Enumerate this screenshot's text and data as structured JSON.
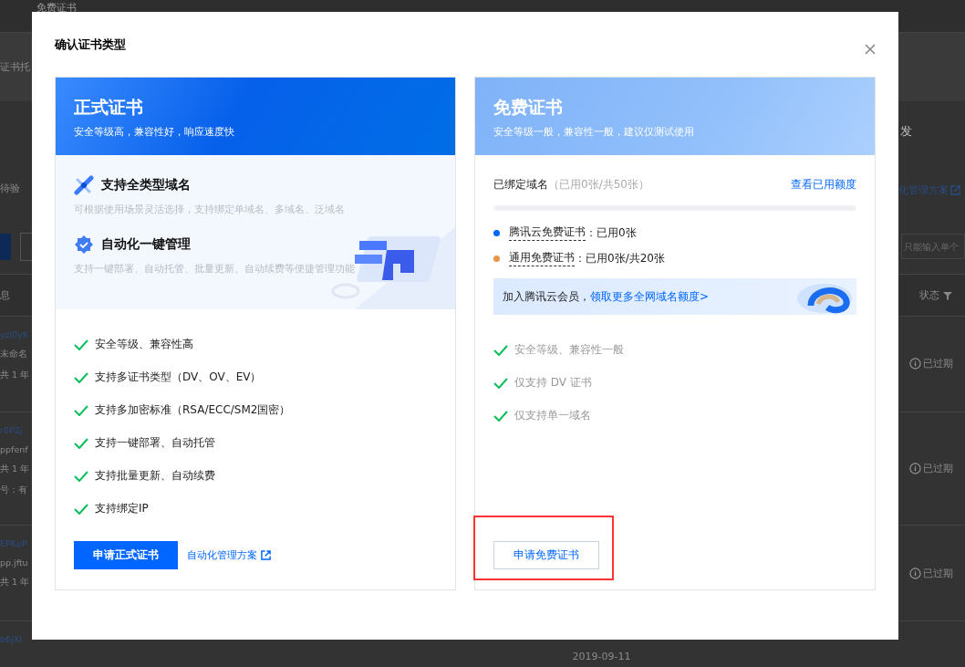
{
  "background": {
    "page_title": "免费证书",
    "tab_label": "证书托",
    "pending_label": "待验",
    "right_heading": "发",
    "right_link": "化管理方案",
    "search_placeholder": "只能输入单个",
    "left_header": "息",
    "status_header": "状态",
    "rows": [
      {
        "lines": [
          "yzl0yK",
          "未命名",
          "共 1 年"
        ],
        "status": "已过期"
      },
      {
        "lines": [
          "r0P2j",
          "ppfenf",
          "共 1 年",
          "号：有"
        ],
        "status": "已过期"
      },
      {
        "lines": [
          "EPKpP",
          "pp.jftu",
          "共 1 年"
        ],
        "status": "已过期"
      },
      {
        "lines": [
          "b6jXI"
        ],
        "status": "",
        "date": "2019-09-11"
      }
    ]
  },
  "dialog": {
    "title": "确认证书类型",
    "cards": [
      {
        "kind": "premium",
        "title": "正式证书",
        "subtitle": "安全等级高，兼容性好，响应速度快",
        "features": [
          {
            "title": "支持全类型域名",
            "desc": "可根据使用场景灵活选择，支持绑定单域名、多域名、泛域名"
          },
          {
            "title": "自动化一键管理",
            "desc": "支持一键部署、自动托管、批量更新、自动续费等便捷管理功能"
          }
        ],
        "checklist": [
          "安全等级、兼容性高",
          "支持多证书类型（DV、OV、EV）",
          "支持多加密标准（RSA/ECC/SM2国密）",
          "支持一键部署、自动托管",
          "支持批量更新、自动续费",
          "支持绑定IP"
        ],
        "button": "申请正式证书",
        "link": "自动化管理方案",
        "highlighted": false
      },
      {
        "kind": "free",
        "title": "免费证书",
        "subtitle": "安全等级一般，兼容性一般，建议仅测试使用",
        "quota": {
          "label": "已绑定域名",
          "usage": "（已用0张/共50张）",
          "link": "查看已用额度",
          "level": 0,
          "items": [
            {
              "name": "腾讯云免费证书",
              "value": "：已用0张",
              "color": "#0066ff"
            },
            {
              "name": "通用免费证书",
              "value": "：已用0张/共20张",
              "color": "#e8954a"
            }
          ],
          "banner": {
            "text": "加入腾讯云会员，",
            "link": "领取更多全网域名额度>"
          }
        },
        "checklist": [
          "安全等级、兼容性一般",
          "仅支持 DV 证书",
          "仅支持单一域名"
        ],
        "button": "申请免费证书",
        "highlighted": true
      }
    ]
  }
}
